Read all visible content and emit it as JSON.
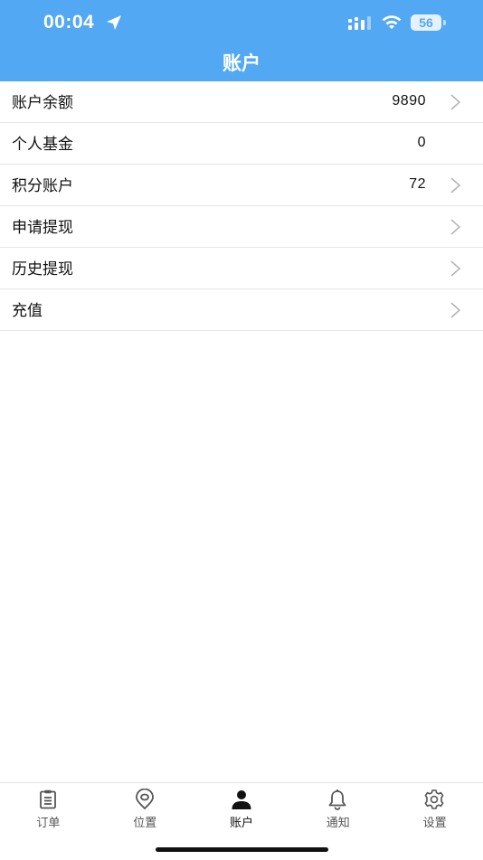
{
  "status_bar": {
    "time": "00:04",
    "battery": "56"
  },
  "header": {
    "title": "账户"
  },
  "rows": [
    {
      "label": "账户余额",
      "value": "9890",
      "chevron": true
    },
    {
      "label": "个人基金",
      "value": "0",
      "chevron": false
    },
    {
      "label": "积分账户",
      "value": "72",
      "chevron": true
    },
    {
      "label": "申请提现",
      "value": "",
      "chevron": true
    },
    {
      "label": "历史提现",
      "value": "",
      "chevron": true
    },
    {
      "label": "充值",
      "value": "",
      "chevron": true
    }
  ],
  "tabs": [
    {
      "label": "订单",
      "icon": "clipboard-icon",
      "active": false
    },
    {
      "label": "位置",
      "icon": "location-pin-icon",
      "active": false
    },
    {
      "label": "账户",
      "icon": "user-icon",
      "active": true
    },
    {
      "label": "通知",
      "icon": "bell-icon",
      "active": false
    },
    {
      "label": "设置",
      "icon": "gear-icon",
      "active": false
    }
  ],
  "colors": {
    "header_bg": "#52a8f2",
    "active_tab": "#111111",
    "inactive_tab": "#555555"
  }
}
